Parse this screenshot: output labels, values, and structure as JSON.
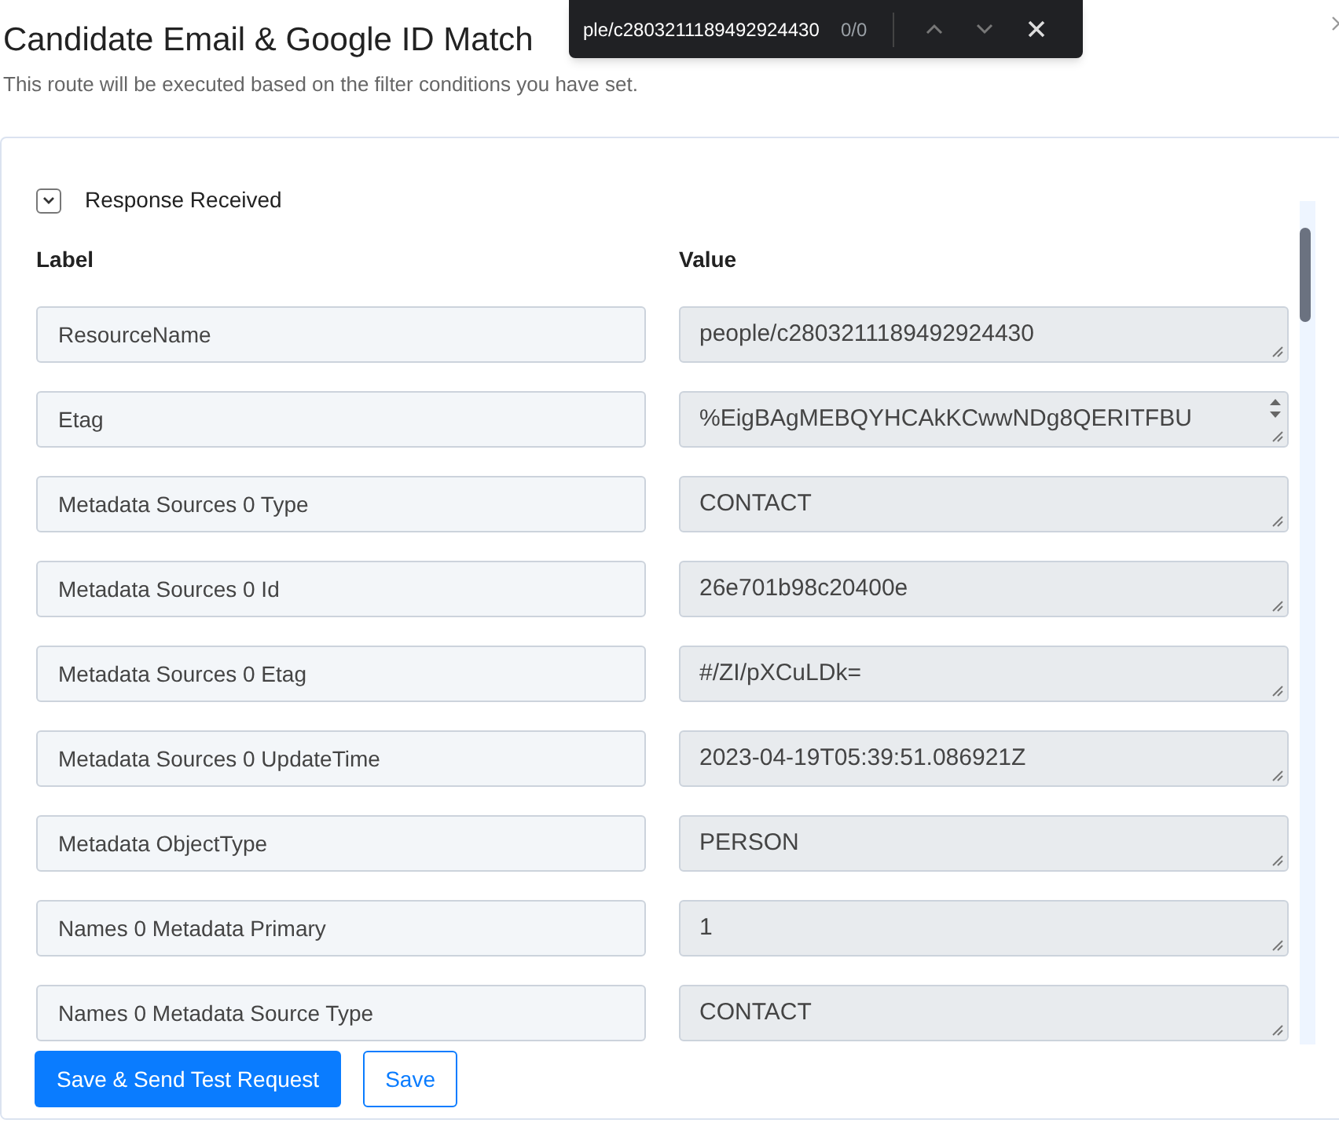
{
  "title": "Candidate Email & Google ID Match",
  "subtitle": "This route will be executed based on the filter conditions you have set.",
  "find_bar": {
    "query": "ple/c2803211189492924430",
    "count": "0/0"
  },
  "section": {
    "label": "Response Received",
    "expanded": true
  },
  "columns": [
    "Label",
    "Value"
  ],
  "rows": [
    {
      "label": "ResourceName",
      "value": "people/c2803211189492924430"
    },
    {
      "label": "Etag",
      "value": "%EigBAgMEBQYHCAkKCwwNDg8QERITFBU",
      "kind": "scroll"
    },
    {
      "label": "Metadata Sources 0 Type",
      "value": "CONTACT"
    },
    {
      "label": "Metadata Sources 0 Id",
      "value": "26e701b98c20400e"
    },
    {
      "label": "Metadata Sources 0 Etag",
      "value": "#/ZI/pXCuLDk="
    },
    {
      "label": "Metadata Sources 0 UpdateTime",
      "value": "2023-04-19T05:39:51.086921Z"
    },
    {
      "label": "Metadata ObjectType",
      "value": "PERSON"
    },
    {
      "label": "Names 0 Metadata Primary",
      "value": "1"
    },
    {
      "label": "Names 0 Metadata Source Type",
      "value": "CONTACT"
    }
  ],
  "buttons": [
    {
      "label": "Save & Send Test Request",
      "kind": "primary"
    },
    {
      "label": "Save",
      "kind": "outline"
    }
  ]
}
